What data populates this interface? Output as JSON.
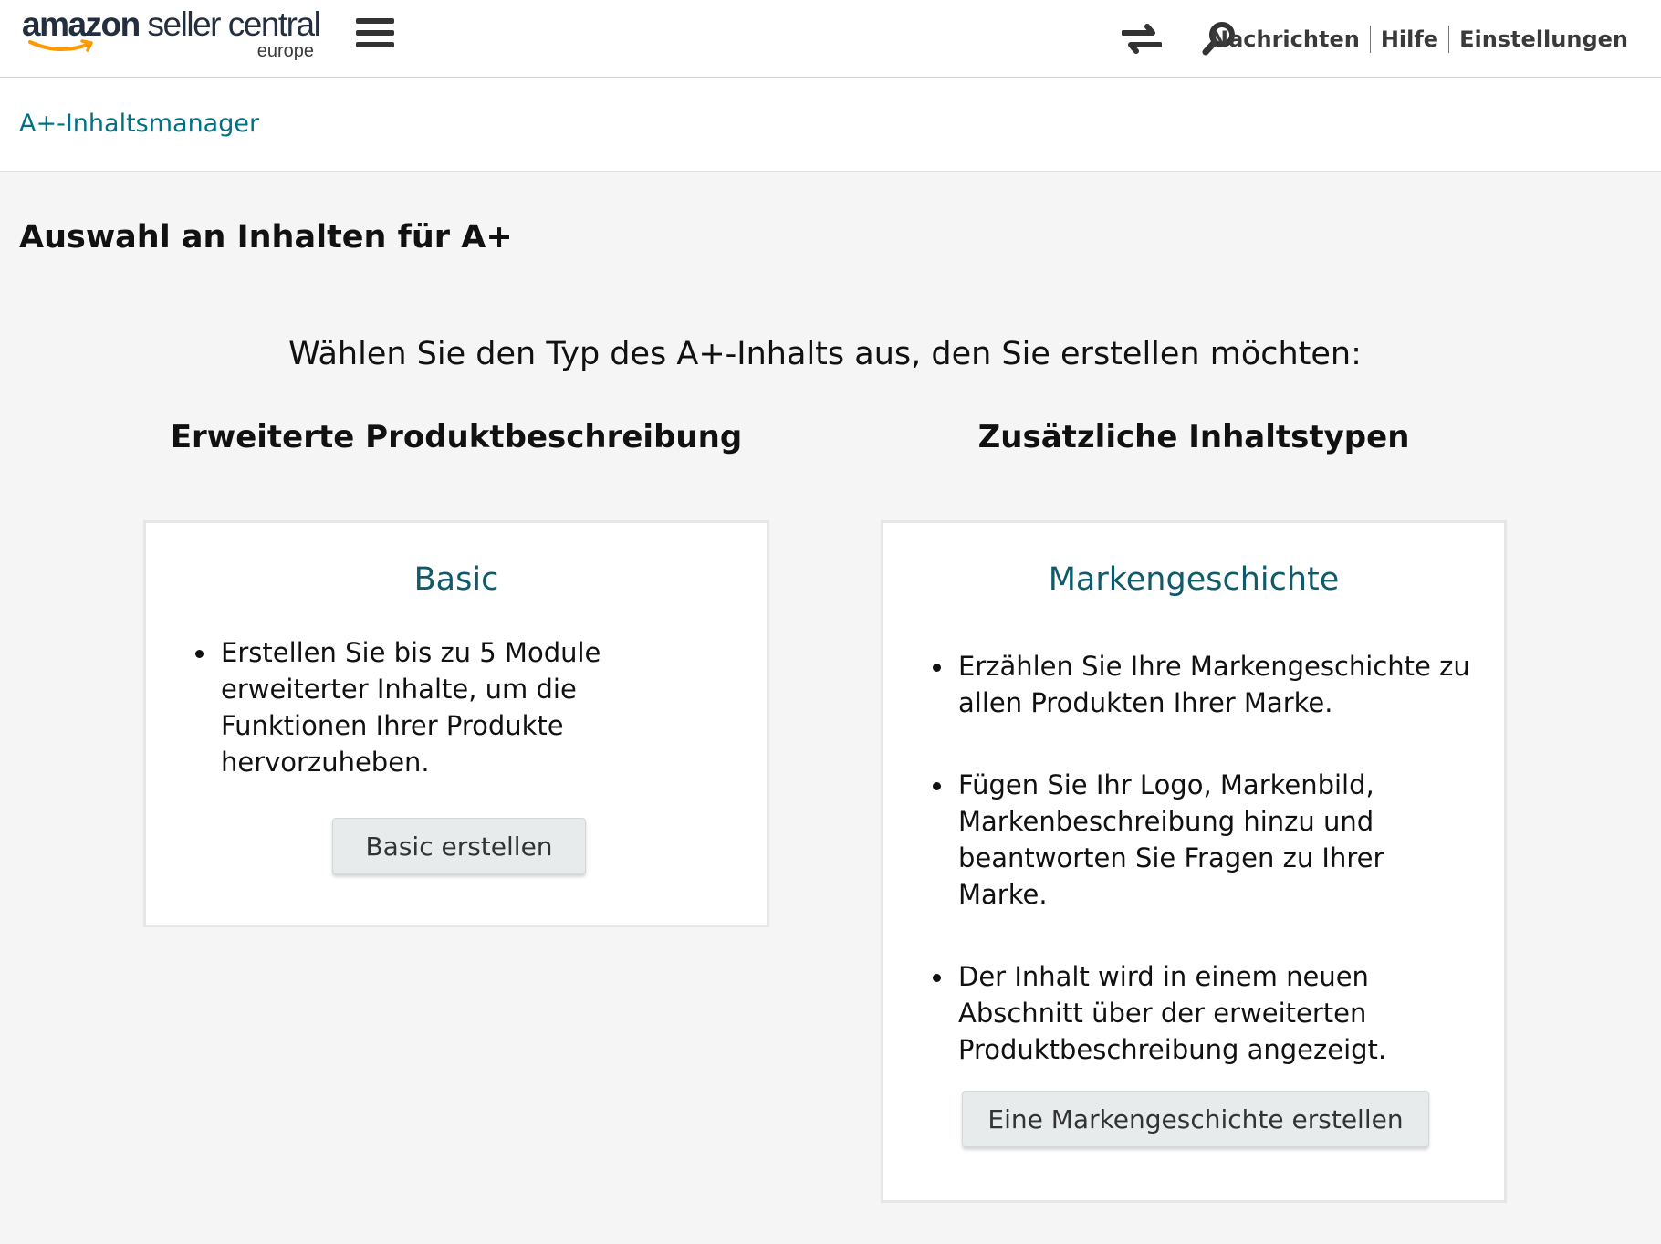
{
  "header": {
    "logo": {
      "brand": "amazon",
      "product": "seller central",
      "region": "europe"
    },
    "menu_icon": "hamburger-menu-icon",
    "switch_icon": "switch-arrows-icon",
    "search_icon": "search-icon",
    "nav": [
      "Nachrichten",
      "Hilfe",
      "Einstellungen"
    ]
  },
  "breadcrumb": "A+-Inhaltsmanager",
  "main": {
    "title": "Auswahl an Inhalten für A+",
    "prompt": "Wählen Sie den Typ des A+-Inhalts aus, den Sie erstellen möchten:",
    "columns": [
      {
        "heading": "Erweiterte Produktbeschreibung",
        "card": {
          "title": "Basic",
          "bullets": [
            "Erstellen Sie bis zu 5 Module erweiterter Inhalte, um die Funktionen Ihrer Produkte hervorzuheben."
          ],
          "button": "Basic erstellen"
        }
      },
      {
        "heading": "Zusätzliche Inhaltstypen",
        "card": {
          "title": "Markengeschichte",
          "bullets": [
            "Erzählen Sie Ihre Markengeschichte zu allen Produkten Ihrer Marke.",
            "Fügen Sie Ihr Logo, Markenbild, Markenbeschreibung hinzu und beantworten Sie Fragen zu Ihrer Marke.",
            "Der Inhalt wird in einem neuen Abschnitt über der erweiterten Produktbeschreibung angezeigt."
          ],
          "button": "Eine Markengeschichte erstellen"
        }
      }
    ]
  },
  "colors": {
    "link": "#007185",
    "card_title": "#0f5b6b",
    "logo_smile": "#ff9900",
    "page_background": "#f5f5f5"
  }
}
